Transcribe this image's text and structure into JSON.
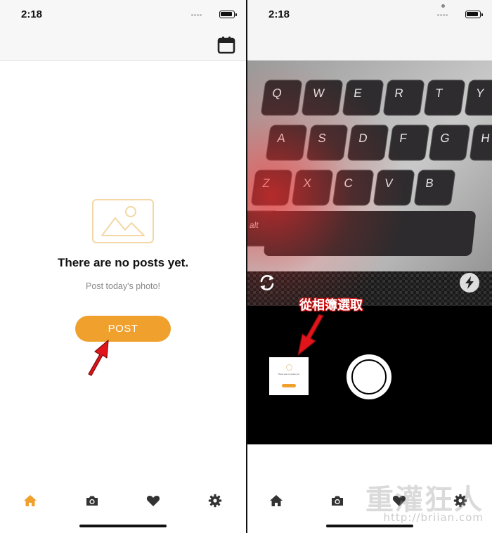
{
  "status_bar": {
    "time": "2:18"
  },
  "feed": {
    "empty_title": "There are no posts yet.",
    "empty_subtitle": "Post today's photo!",
    "post_button": "POST"
  },
  "tabs": [
    {
      "icon": "home-icon",
      "active": true
    },
    {
      "icon": "camera-icon",
      "active": false
    },
    {
      "icon": "heart-icon",
      "active": false
    },
    {
      "icon": "gear-icon",
      "active": false
    }
  ],
  "camera": {
    "annotation_label": "從相簿選取",
    "thumbnail": {
      "title": "There are no posts yet.",
      "button": "POST"
    },
    "preview_keys": [
      "Q",
      "W",
      "E",
      "R",
      "T",
      "Y",
      "A",
      "S",
      "D",
      "F",
      "G",
      "H",
      "Z",
      "X",
      "C",
      "V",
      "B",
      "alt"
    ]
  },
  "watermark": {
    "brand": "重灌狂人",
    "url": "http://briian.com"
  },
  "colors": {
    "accent": "#f0a02d",
    "tab_active": "#f0a02d",
    "tab_inactive": "#333333",
    "annotation_red": "#e0141a",
    "camera_bg": "#000000"
  }
}
